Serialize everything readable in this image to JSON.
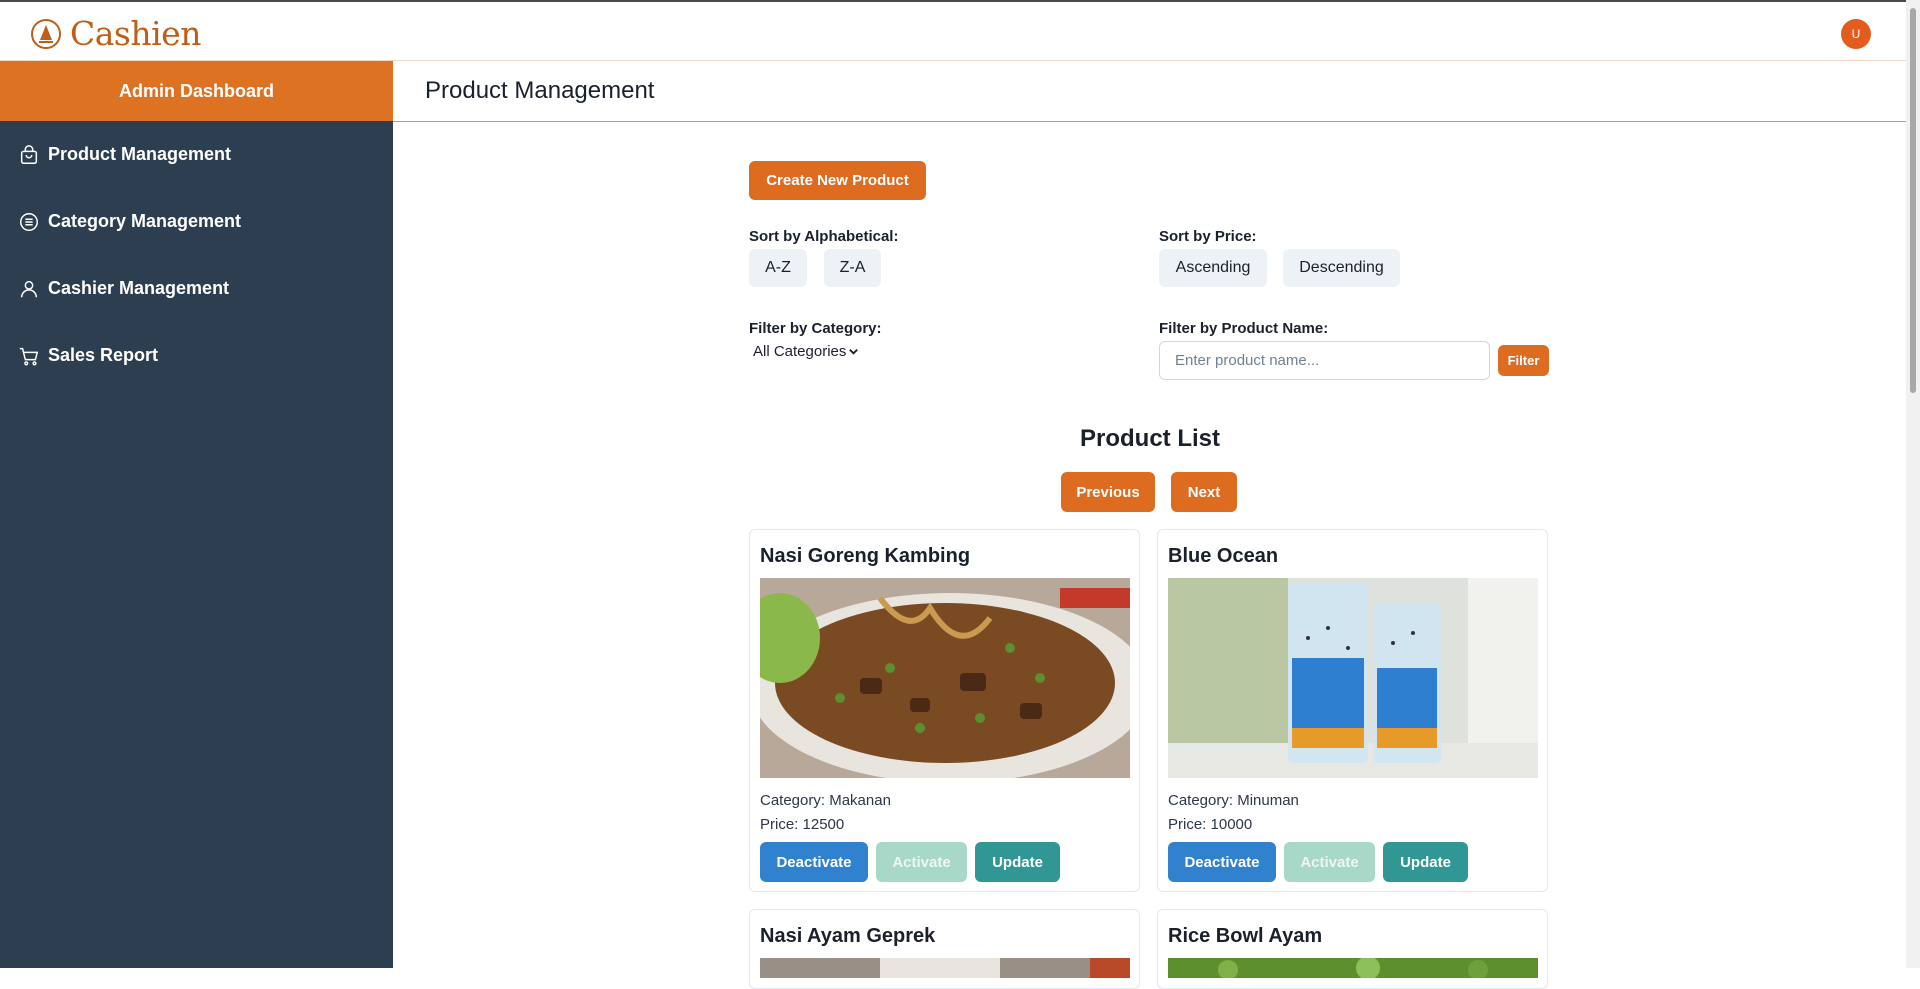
{
  "app": {
    "logo_text": "Cashien",
    "avatar_initial": "U"
  },
  "sidebar": {
    "header": "Admin Dashboard",
    "items": [
      {
        "label": "Product Management",
        "icon": "shopping-bag-icon"
      },
      {
        "label": "Category Management",
        "icon": "list-icon"
      },
      {
        "label": "Cashier Management",
        "icon": "user-icon"
      },
      {
        "label": "Sales Report",
        "icon": "cart-icon"
      }
    ]
  },
  "page": {
    "title": "Product Management"
  },
  "controls": {
    "create_label": "Create New Product",
    "sort_alpha_label": "Sort by Alphabetical:",
    "az_label": "A-Z",
    "za_label": "Z-A",
    "sort_price_label": "Sort by Price:",
    "asc_label": "Ascending",
    "desc_label": "Descending",
    "filter_category_label": "Filter by Category:",
    "category_selected": "All Categories",
    "filter_name_label": "Filter by Product Name:",
    "name_placeholder": "Enter product name...",
    "filter_button": "Filter"
  },
  "list": {
    "title": "Product List",
    "prev_label": "Previous",
    "next_label": "Next"
  },
  "products": [
    {
      "name": "Nasi Goreng Kambing",
      "category": "Category: Makanan",
      "price": "Price: 12500",
      "deactivate": "Deactivate",
      "activate": "Activate",
      "update": "Update"
    },
    {
      "name": "Blue Ocean",
      "category": "Category: Minuman",
      "price": "Price: 10000",
      "deactivate": "Deactivate",
      "activate": "Activate",
      "update": "Update"
    },
    {
      "name": "Nasi Ayam Geprek"
    },
    {
      "name": "Rice Bowl Ayam"
    }
  ],
  "colors": {
    "accent": "#dd6b20",
    "sidebar_bg": "#2d3e50",
    "blue": "#3182ce",
    "teal": "#319795"
  }
}
